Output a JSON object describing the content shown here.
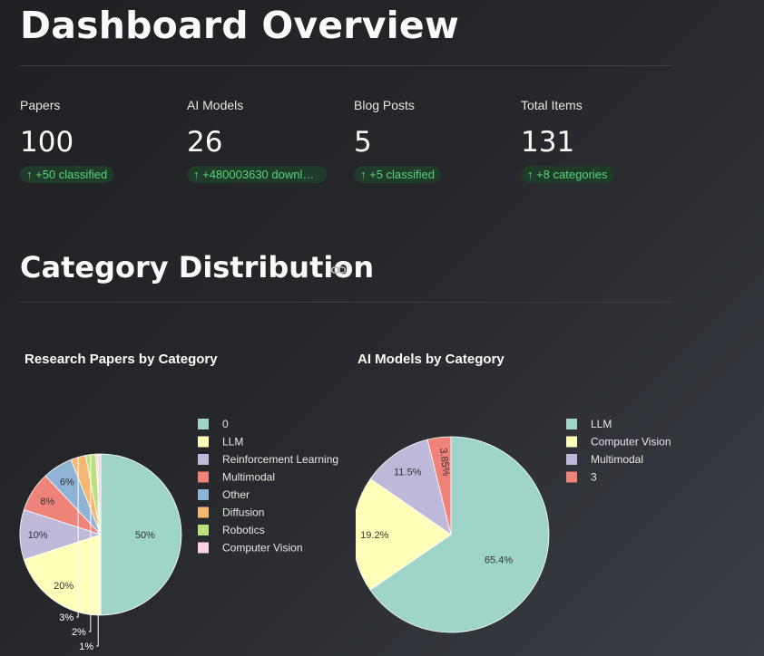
{
  "page_title": "Dashboard Overview",
  "metrics": [
    {
      "label": "Papers",
      "value": "100",
      "delta": "↑ +50 classified"
    },
    {
      "label": "AI Models",
      "value": "26",
      "delta": "↑ +480003630 downloa…"
    },
    {
      "label": "Blog Posts",
      "value": "5",
      "delta": "↑ +5 classified"
    },
    {
      "label": "Total Items",
      "value": "131",
      "delta": "↑ +8 categories"
    }
  ],
  "section_title": "Category Distribution",
  "colors": {
    "delta_bg": "#1f3b2a",
    "delta_text": "#59d377",
    "palette": [
      "#9fd4c8",
      "#ffffba",
      "#bfb9d9",
      "#f08379",
      "#8fb3d4",
      "#f5b872",
      "#bde07f",
      "#fbd1e6"
    ]
  },
  "chart_data": [
    {
      "type": "pie",
      "title": "Research Papers by Category",
      "categories": [
        "0",
        "LLM",
        "Reinforcement Learning",
        "Multimodal",
        "Other",
        "Diffusion",
        "Robotics",
        "Computer Vision"
      ],
      "values": [
        50,
        20,
        10,
        8,
        6,
        3,
        2,
        1
      ],
      "labels": [
        "50%",
        "20%",
        "10%",
        "8%",
        "6%",
        "3%",
        "2%",
        "1%"
      ],
      "legend": "right"
    },
    {
      "type": "pie",
      "title": "AI Models by Category",
      "categories": [
        "LLM",
        "Computer Vision",
        "Multimodal",
        "3"
      ],
      "values": [
        65.4,
        19.2,
        11.5,
        3.85
      ],
      "labels": [
        "65.4%",
        "19.2%",
        "11.5%",
        "3.85%"
      ],
      "legend": "right"
    }
  ]
}
